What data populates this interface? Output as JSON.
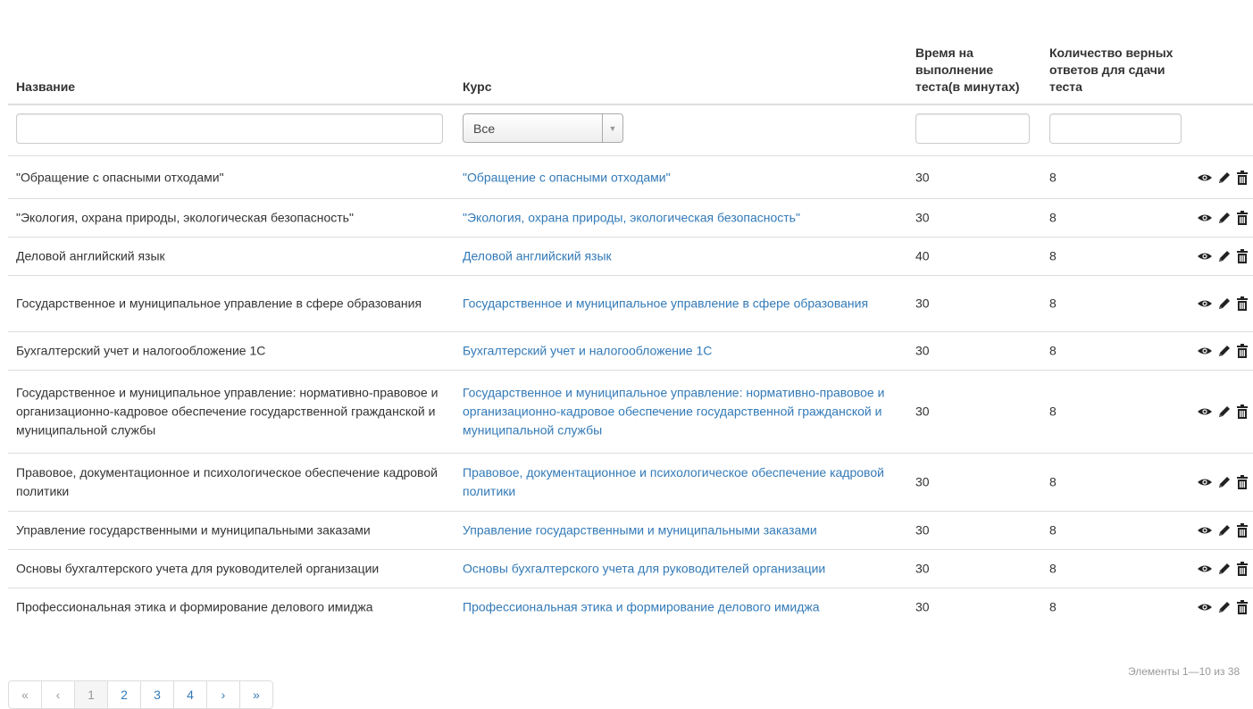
{
  "columns": {
    "name": "Название",
    "course": "Курс",
    "time": "Время на выполнение теста(в минутах)",
    "count": "Количество верных ответов для сдачи теста"
  },
  "filters": {
    "course_selected": "Все"
  },
  "rows": [
    {
      "name": "\"Обращение с опасными отходами\"",
      "course": "\"Обращение с опасными отходами\"",
      "time": "30",
      "count": "8"
    },
    {
      "name": "\"Экология, охрана природы, экологическая безопасность\"",
      "course": "\"Экология, охрана природы, экологическая безопасность\"",
      "time": "30",
      "count": "8"
    },
    {
      "name": "Деловой английский язык",
      "course": "Деловой английский язык",
      "time": "40",
      "count": "8"
    },
    {
      "name": "Государственное и муниципальное управление в сфере образования",
      "course": "Государственное и муниципальное управление в сфере образования",
      "time": "30",
      "count": "8"
    },
    {
      "name": "Бухгалтерский учет и налогообложение 1С",
      "course": "Бухгалтерский учет и налогообложение 1С",
      "time": "30",
      "count": "8"
    },
    {
      "name": "Государственное и муниципальное управление: нормативно-правовое и организационно-кадровое обеспечение государственной гражданской и муниципальной службы",
      "course": "Государственное и муниципальное управление: нормативно-правовое и организационно-кадровое обеспечение государственной гражданской и муниципальной службы",
      "time": "30",
      "count": "8"
    },
    {
      "name": "Правовое, документационное и психологическое обеспечение кадровой политики",
      "course": "Правовое, документационное и психологическое обеспечение кадровой политики",
      "time": "30",
      "count": "8"
    },
    {
      "name": "Управление государственными и муниципальными заказами",
      "course": "Управление государственными и муниципальными заказами",
      "time": "30",
      "count": "8"
    },
    {
      "name": "Основы бухгалтерского учета для руководителей организации",
      "course": "Основы бухгалтерского учета для руководителей организации",
      "time": "30",
      "count": "8"
    },
    {
      "name": "Профессиональная этика и формирование делового имиджа",
      "course": "Профессиональная этика и формирование делового имиджа",
      "time": "30",
      "count": "8"
    }
  ],
  "icons": {
    "view": "eye-icon",
    "edit": "pencil-icon",
    "delete": "trash-icon"
  },
  "pager": {
    "first": "«",
    "prev": "‹",
    "pages": [
      "1",
      "2",
      "3",
      "4"
    ],
    "active_page": "1",
    "next": "›",
    "last": "»"
  },
  "summary": "Элементы 1—10 из 38",
  "colors": {
    "link": "#337ab7",
    "text": "#333333",
    "border": "#dddddd",
    "muted": "#999999"
  }
}
